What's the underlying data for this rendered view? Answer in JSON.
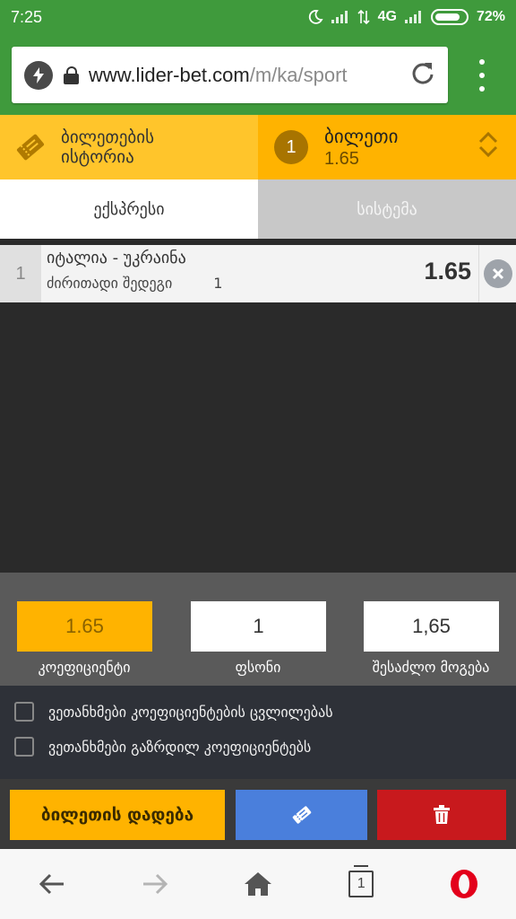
{
  "status_bar": {
    "time": "7:25",
    "network": "4G",
    "battery": "72%"
  },
  "browser": {
    "url_host": "www.lider-bet.com",
    "url_path": "/m/ka/sport"
  },
  "bet_header": {
    "history_label": "ბილეთების ისტორია",
    "ticket_title": "ბილეთი",
    "ticket_count": "1",
    "ticket_odds": "1.65"
  },
  "tabs": [
    {
      "label": "ექსპრესი",
      "active": true
    },
    {
      "label": "სისტემა",
      "active": false
    }
  ],
  "bet": {
    "index": "1",
    "match": "იტალია - უკრაინა",
    "market": "ძირითადი შედეგი",
    "selection": "1",
    "odds": "1.65"
  },
  "stake_panel": {
    "odds_value": "1.65",
    "stake_value": "1",
    "win_value": "1,65",
    "odds_label": "კოეფიციენტი",
    "stake_label": "ფსონი",
    "win_label": "შესაძლო მოგება"
  },
  "agreements": [
    "ვეთანხმები კოეფიციენტების ცვლილებას",
    "ვეთანხმები გაზრდილ კოეფიციენტებს"
  ],
  "actions": {
    "place_label": "ბილეთის დადება"
  },
  "colors": {
    "chrome_green": "#3f9a3c",
    "accent_yellow": "#ffb300",
    "history_yellow": "#ffc52b",
    "share_blue": "#4a7fdc",
    "delete_red": "#c8191d",
    "opera_red": "#e3001b"
  },
  "icons": {
    "bolt": "bolt-icon",
    "lock": "lock-icon",
    "reload": "reload-icon",
    "menu": "more-vert-icon",
    "ticket": "ticket-icon",
    "expand": "chevron-up-down-icon",
    "remove": "close-circle-icon",
    "share": "ticket-share-icon",
    "delete": "trash-icon",
    "back": "arrow-left-icon",
    "forward": "arrow-right-icon",
    "home": "home-icon",
    "tabs": "tabs-icon",
    "opera": "opera-logo-icon"
  }
}
